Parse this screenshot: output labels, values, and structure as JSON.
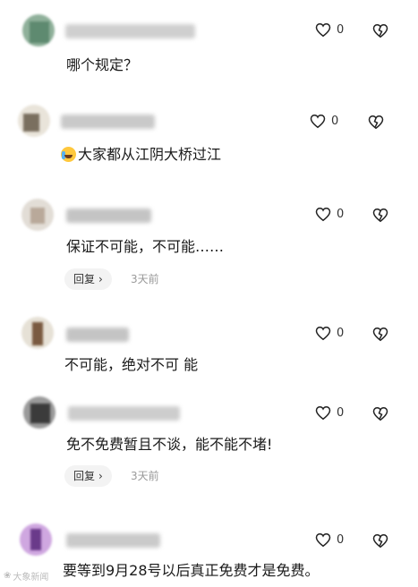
{
  "comments": [
    {
      "text": "哪个规定？",
      "likes": "0"
    },
    {
      "text": "大家都从江阴大桥过江",
      "likes": "0",
      "emoji": "crying-laughing-emoji"
    },
    {
      "text": "保证不可能，不可能……",
      "likes": "0",
      "reply": "回复",
      "time": "3天前"
    },
    {
      "text": "不可能，绝对不可 能",
      "likes": "0"
    },
    {
      "text": "免不免费暂且不谈，能不能不堵!",
      "likes": "0",
      "reply": "回复",
      "time": "3天前"
    },
    {
      "text": "要等到9月28号以后真正免费才是免费。",
      "likes": "0"
    }
  ],
  "icons": {
    "like": "heart-outline-icon",
    "dislike": "broken-heart-icon",
    "reply_arrow": "chevron-right-icon"
  },
  "watermark": "大象新闻"
}
